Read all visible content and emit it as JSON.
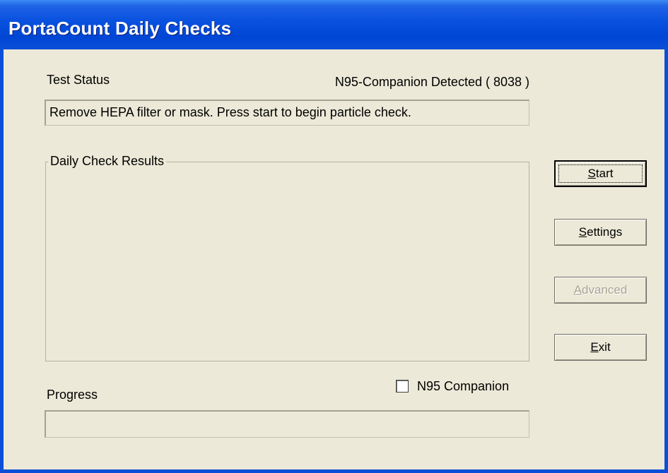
{
  "window": {
    "title": "PortaCount Daily Checks"
  },
  "test_status": {
    "label": "Test Status",
    "device": "N95-Companion Detected ( 8038 )",
    "message": "Remove HEPA filter or mask. Press start to begin particle check."
  },
  "results": {
    "label": "Daily Check Results",
    "items": []
  },
  "buttons": {
    "start": {
      "label": "Start",
      "mnemonic": "S",
      "enabled": true,
      "default": true
    },
    "settings": {
      "label": "Settings",
      "mnemonic": "S",
      "enabled": true
    },
    "advanced": {
      "label": "Advanced",
      "mnemonic": "A",
      "enabled": false
    },
    "exit": {
      "label": "Exit",
      "mnemonic": "E",
      "enabled": true
    }
  },
  "n95_companion": {
    "label": "N95 Companion",
    "checked": false
  },
  "progress": {
    "label": "Progress",
    "fraction": 0
  },
  "colors": {
    "titlebar": "#0a52e0",
    "face": "#ece9d8",
    "border": "#0b4fd8"
  }
}
